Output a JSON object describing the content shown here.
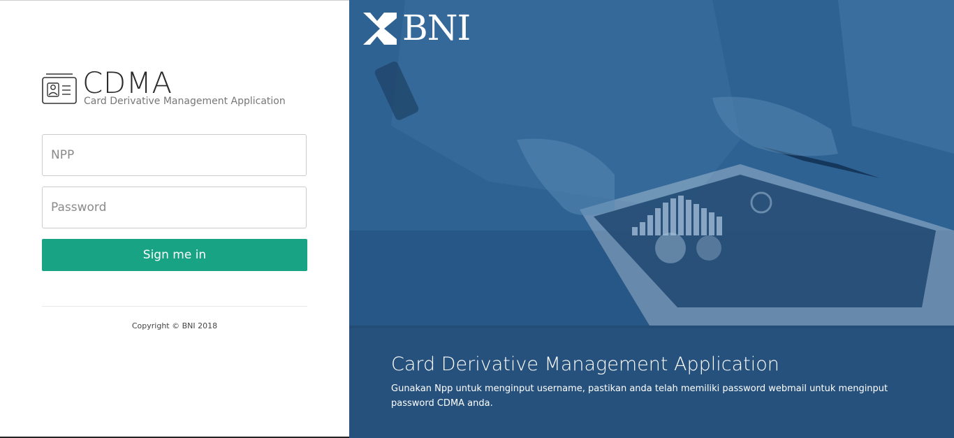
{
  "brand": {
    "title": "CDMA",
    "subtitle": "Card Derivative Management Application",
    "icon": "id-card-icon"
  },
  "form": {
    "npp_placeholder": "NPP",
    "password_placeholder": "Password",
    "npp_value": "",
    "password_value": "",
    "signin_label": "Sign me in"
  },
  "footer": {
    "copyright": "Copyright © BNI 2018"
  },
  "hero": {
    "logo_text": "BNI",
    "caption_title": "Card Derivative Management Application",
    "caption_text": "Gunakan Npp untuk menginput username, pastikan anda telah memiliki password webmail untuk menginput password CDMA anda."
  },
  "colors": {
    "accent": "#18a385",
    "hero_blue": "#2e6595"
  }
}
